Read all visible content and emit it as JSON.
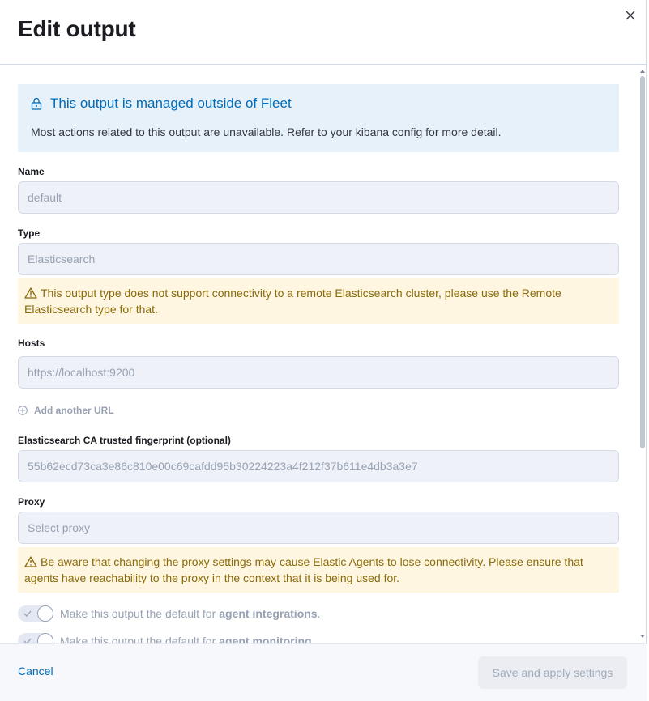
{
  "flyout": {
    "title": "Edit output",
    "close_icon": "close-icon"
  },
  "managed_callout": {
    "icon": "lock-icon",
    "title": "This output is managed outside of Fleet",
    "text": "Most actions related to this output are unavailable. Refer to your kibana config for more detail."
  },
  "fields": {
    "name": {
      "label": "Name",
      "value": "default"
    },
    "type": {
      "label": "Type",
      "value": "Elasticsearch"
    },
    "type_warning": "This output type does not support connectivity to a remote Elasticsearch cluster, please use the Remote Elasticsearch type for that.",
    "hosts": {
      "label": "Hosts",
      "value": "https://localhost:9200"
    },
    "add_url": "Add another URL",
    "fingerprint": {
      "label": "Elasticsearch CA trusted fingerprint (optional)",
      "value": "55b62ecd73ca3e86c810e00c69cafdd95b30224223a4f212f37b611e4db3a3e7"
    },
    "proxy": {
      "label": "Proxy",
      "placeholder": "Select proxy"
    },
    "proxy_warning": "Be aware that changing the proxy settings may cause Elastic Agents to lose connectivity. Please ensure that agents have reachability to the proxy in the context that it is being used for."
  },
  "switches": [
    {
      "text": "Make this output the default for",
      "bold": "agent integrations",
      "suffix": ".",
      "checked": true
    },
    {
      "text": "Make this output the default for",
      "bold": "agent monitoring",
      "suffix": ".",
      "checked": true
    }
  ],
  "footer": {
    "cancel": "Cancel",
    "save": "Save and apply settings"
  },
  "colors": {
    "link": "#006bb8",
    "info_bg": "#e6f1fa",
    "warning_bg": "#fef6e1",
    "warning_text": "#8a6a0a"
  }
}
